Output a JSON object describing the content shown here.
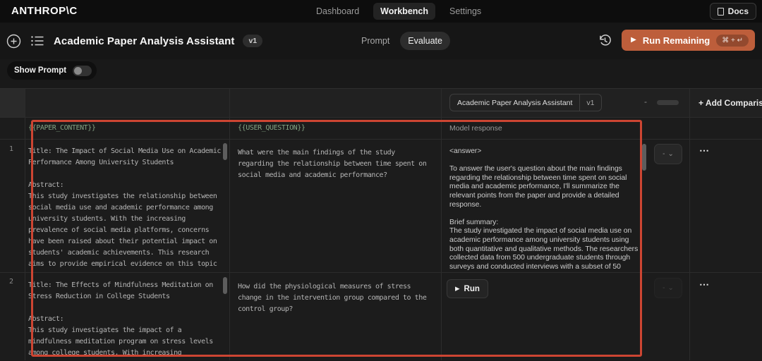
{
  "nav": {
    "logo": "ANTHROP\\C",
    "items": [
      "Dashboard",
      "Workbench",
      "Settings"
    ],
    "docs": "Docs"
  },
  "toolbar": {
    "title": "Academic Paper Analysis Assistant",
    "version": "v1",
    "tabs": [
      "Prompt",
      "Evaluate"
    ],
    "run_label": "Run Remaining",
    "run_shortcut": "⌘ + ↵"
  },
  "controls": {
    "show_prompt": "Show Prompt"
  },
  "table": {
    "response_column": {
      "name": "Academic Paper Analysis Assistant",
      "version": "v1",
      "score": "-",
      "header": "Model response"
    },
    "add_comparison": "+ Add Comparison",
    "template_columns": {
      "paper": "{{PAPER_CONTENT}}",
      "question": "{{USER_QUESTION}}"
    },
    "rows": [
      {
        "index": "1",
        "paper": "Title: The Impact of Social Media Use on Academic Performance Among University Students\n\nAbstract:\nThis study investigates the relationship between social media use and academic performance among university students. With the increasing prevalence of social media platforms, concerns have been raised about their potential impact on students' academic achievements. This research aims to provide empirical evidence on this topic through a",
        "question": "What were the main findings of the study regarding the relationship between time spent on social media and academic performance?",
        "response": "<answer>\n\nTo answer the user's question about the main findings regarding the relationship between time spent on social media and academic performance, I'll summarize the relevant points from the paper and provide a detailed response.\n\nBrief summary:\nThe study investigated the impact of social media use on academic performance among university students using both quantitative and qualitative methods. The researchers collected data from 500 undergraduate students through surveys and conducted interviews with a subset of 50",
        "score": "-"
      },
      {
        "index": "2",
        "paper": "Title: The Effects of Mindfulness Meditation on Stress Reduction in College Students\n\nAbstract:\nThis study investigates the impact of a mindfulness meditation program on stress levels among college students. With increasing",
        "question": "How did the physiological measures of stress change in the intervention group compared to the control group?",
        "run_label": "Run",
        "score": "-"
      }
    ]
  },
  "icons": {
    "more": "⋯",
    "chevron_down": "⌄",
    "play": "▶"
  },
  "colors": {
    "accent_orange": "#bd5e3b",
    "annotation_red": "#cd4532",
    "template_green": "#84a383"
  }
}
